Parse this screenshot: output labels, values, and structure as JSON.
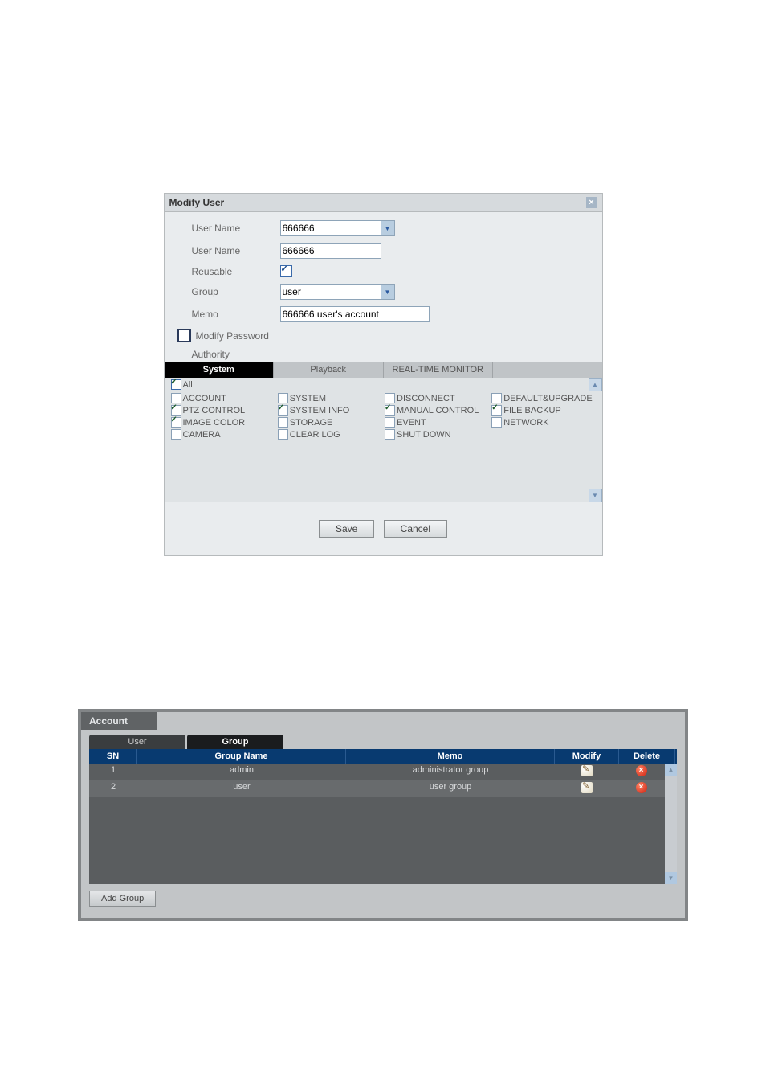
{
  "dialog": {
    "title": "Modify User",
    "fields": {
      "user_name_label": "User Name",
      "user_name_select": "666666",
      "user_name2_label": "User Name",
      "user_name2_value": "666666",
      "reusable_label": "Reusable",
      "reusable_checked": true,
      "group_label": "Group",
      "group_value": "user",
      "memo_label": "Memo",
      "memo_value": "666666 user's account",
      "modify_password_label": "Modify Password",
      "authority_label": "Authority"
    },
    "tabs": {
      "system": "System",
      "playback": "Playback",
      "realtime": "REAL-TIME MONITOR"
    },
    "all_label": "All",
    "perms": {
      "col1": [
        {
          "label": "ACCOUNT",
          "checked": false
        },
        {
          "label": "PTZ CONTROL",
          "checked": true
        },
        {
          "label": "IMAGE COLOR",
          "checked": true
        },
        {
          "label": "CAMERA",
          "checked": false
        }
      ],
      "col2": [
        {
          "label": "SYSTEM",
          "checked": false
        },
        {
          "label": "SYSTEM INFO",
          "checked": true
        },
        {
          "label": "STORAGE",
          "checked": false
        },
        {
          "label": "CLEAR LOG",
          "checked": false
        }
      ],
      "col3": [
        {
          "label": "DISCONNECT",
          "checked": false
        },
        {
          "label": "MANUAL CONTROL",
          "checked": true
        },
        {
          "label": "EVENT",
          "checked": false
        },
        {
          "label": "SHUT DOWN",
          "checked": false
        }
      ],
      "col4": [
        {
          "label": "DEFAULT&UPGRADE",
          "checked": false
        },
        {
          "label": "FILE BACKUP",
          "checked": true
        },
        {
          "label": "NETWORK",
          "checked": false
        }
      ]
    },
    "buttons": {
      "save": "Save",
      "cancel": "Cancel"
    }
  },
  "account": {
    "header": "Account",
    "tabs": {
      "user": "User",
      "group": "Group"
    },
    "columns": {
      "sn": "SN",
      "group_name": "Group Name",
      "memo": "Memo",
      "modify": "Modify",
      "delete": "Delete"
    },
    "rows": [
      {
        "sn": "1",
        "name": "admin",
        "memo": "administrator group"
      },
      {
        "sn": "2",
        "name": "user",
        "memo": "user group"
      }
    ],
    "add_group": "Add Group"
  }
}
